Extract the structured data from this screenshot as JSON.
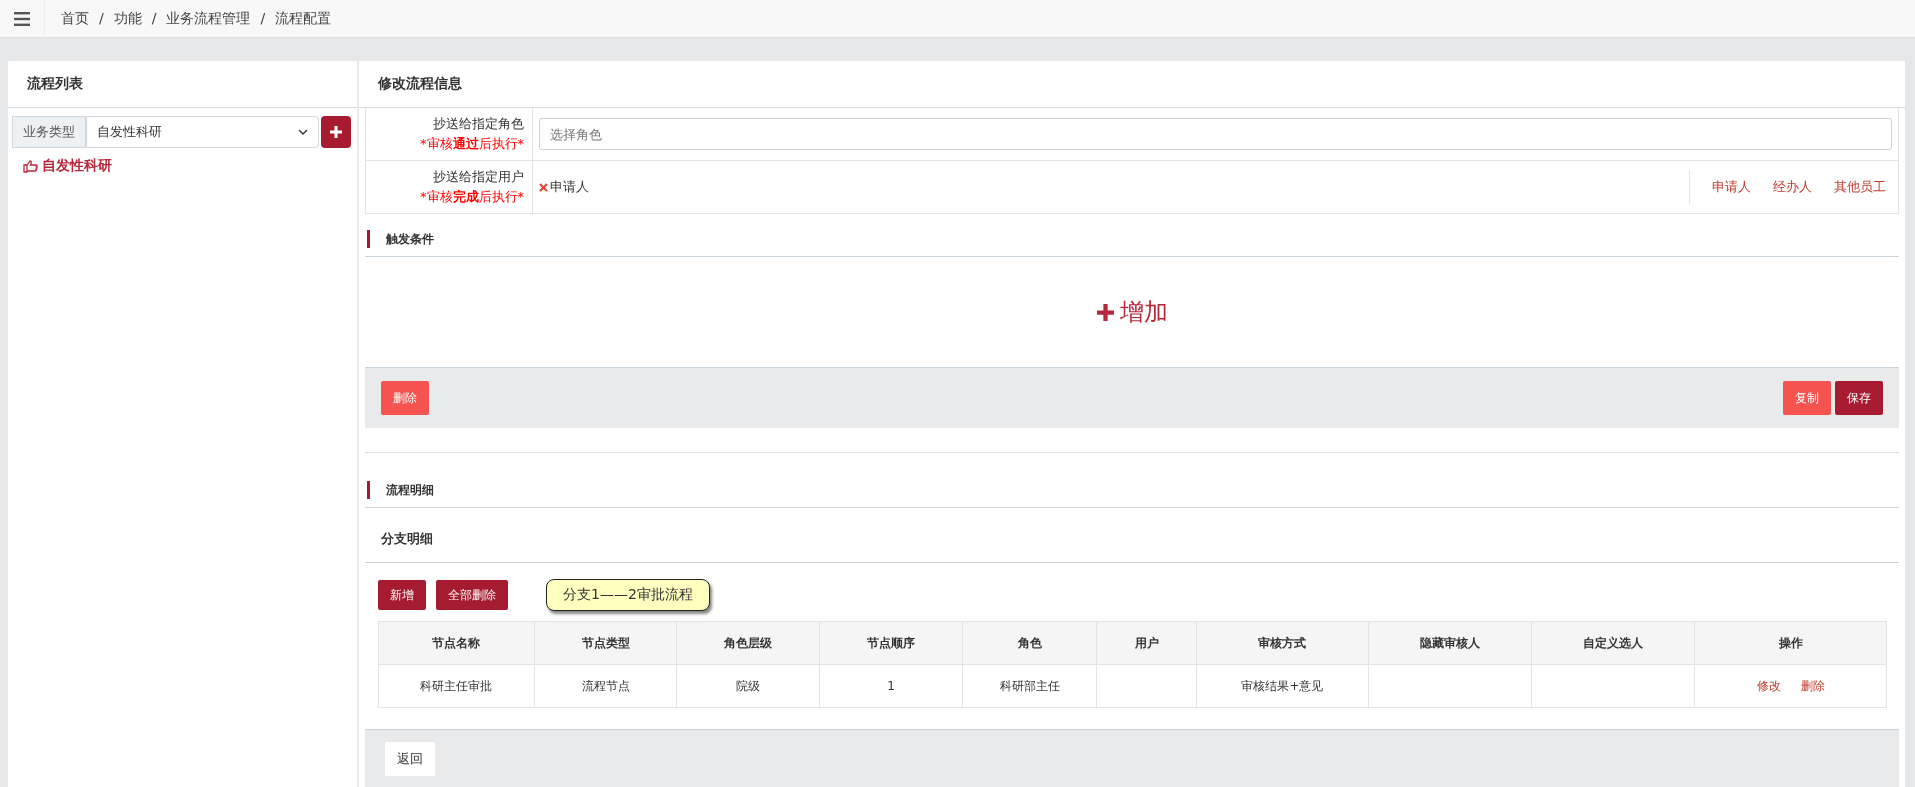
{
  "breadcrumb": [
    "首页",
    "功能",
    "业务流程管理",
    "流程配置"
  ],
  "breadcrumb_separator": "/",
  "sidebar": {
    "title": "流程列表",
    "filter_label": "业务类型",
    "filter_value": "自发性科研",
    "items": [
      {
        "label": "自发性科研",
        "selected": true
      }
    ]
  },
  "main": {
    "title": "修改流程信息",
    "form_rows": [
      {
        "label": "抄送给指定角色",
        "note_pre": "*审核",
        "note_bold": "通过",
        "note_post": "后执行*",
        "kind": "input",
        "placeholder": "选择角色"
      },
      {
        "label": "抄送给指定用户",
        "note_pre": "*审核",
        "note_bold": "完成",
        "note_post": "后执行*",
        "kind": "tags",
        "tags": [
          "申请人"
        ],
        "links": [
          "申请人",
          "经办人",
          "其他员工"
        ]
      }
    ],
    "trigger": {
      "title": "触发条件",
      "add_label": "增加"
    },
    "actions_left": [
      "删除"
    ],
    "actions_right": [
      {
        "label": "复制",
        "kind": "light"
      },
      {
        "label": "保存",
        "kind": "dark"
      }
    ],
    "detail_title": "流程明细",
    "branch_title": "分支明细",
    "branch_buttons": [
      "新增",
      "全部删除"
    ],
    "branch_tooltip": "分支1——2审批流程",
    "table": {
      "columns": [
        "节点名称",
        "节点类型",
        "角色层级",
        "节点顺序",
        "角色",
        "用户",
        "审核方式",
        "隐藏审核人",
        "自定义选人",
        "操作"
      ],
      "rows": [
        {
          "cells": [
            "科研主任审批",
            "流程节点",
            "院级",
            "1",
            "科研部主任",
            "",
            "审核结果+意见",
            "",
            ""
          ],
          "actions": [
            "修改",
            "删除"
          ]
        }
      ]
    },
    "back": "返回"
  }
}
